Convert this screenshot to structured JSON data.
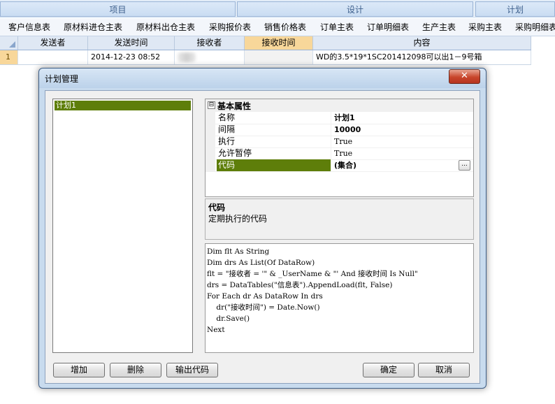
{
  "groups": [
    "项目",
    "设计",
    "计划"
  ],
  "tabs": [
    "客户信息表",
    "原材料进仓主表",
    "原材料出仓主表",
    "采购报价表",
    "销售价格表",
    "订单主表",
    "订单明细表",
    "生产主表",
    "采购主表",
    "采购明细表"
  ],
  "grid": {
    "columns": [
      "发送者",
      "发送时间",
      "接收者",
      "接收时间",
      "内容"
    ],
    "row": {
      "number": "1",
      "sender": "",
      "send_time": "2014-12-23 08:52",
      "receiver": "",
      "receive_time": "",
      "content": "WD的3.5*19*1SC201412098可以出1－9号箱"
    }
  },
  "dialog": {
    "title": "计划管理",
    "close_label": "✕",
    "plans": [
      "计划1"
    ],
    "property_category": "基本属性",
    "category_toggle": "⊟",
    "properties": [
      {
        "name": "名称",
        "value": "计划1"
      },
      {
        "name": "间隔",
        "value": "10000"
      },
      {
        "name": "执行",
        "value": "True"
      },
      {
        "name": "允许暂停",
        "value": "True"
      },
      {
        "name": "代码",
        "value": "(集合)"
      }
    ],
    "ellipsis_label": "...",
    "help": {
      "title": "代码",
      "text": "定期执行的代码"
    },
    "code_lines": [
      "Dim flt As String",
      "Dim drs As List(Of DataRow)",
      "flt = \"接收者 = '\" & _UserName & \"' And 接收时间 Is Null\"",
      "drs = DataTables(\"信息表\").AppendLoad(flt, False)",
      "For Each dr As DataRow In drs",
      "    dr(\"接收时间\") = Date.Now()",
      "    dr.Save()",
      "Next"
    ],
    "buttons": {
      "add": "增加",
      "delete": "删除",
      "export": "输出代码",
      "ok": "确定",
      "cancel": "取消"
    }
  }
}
